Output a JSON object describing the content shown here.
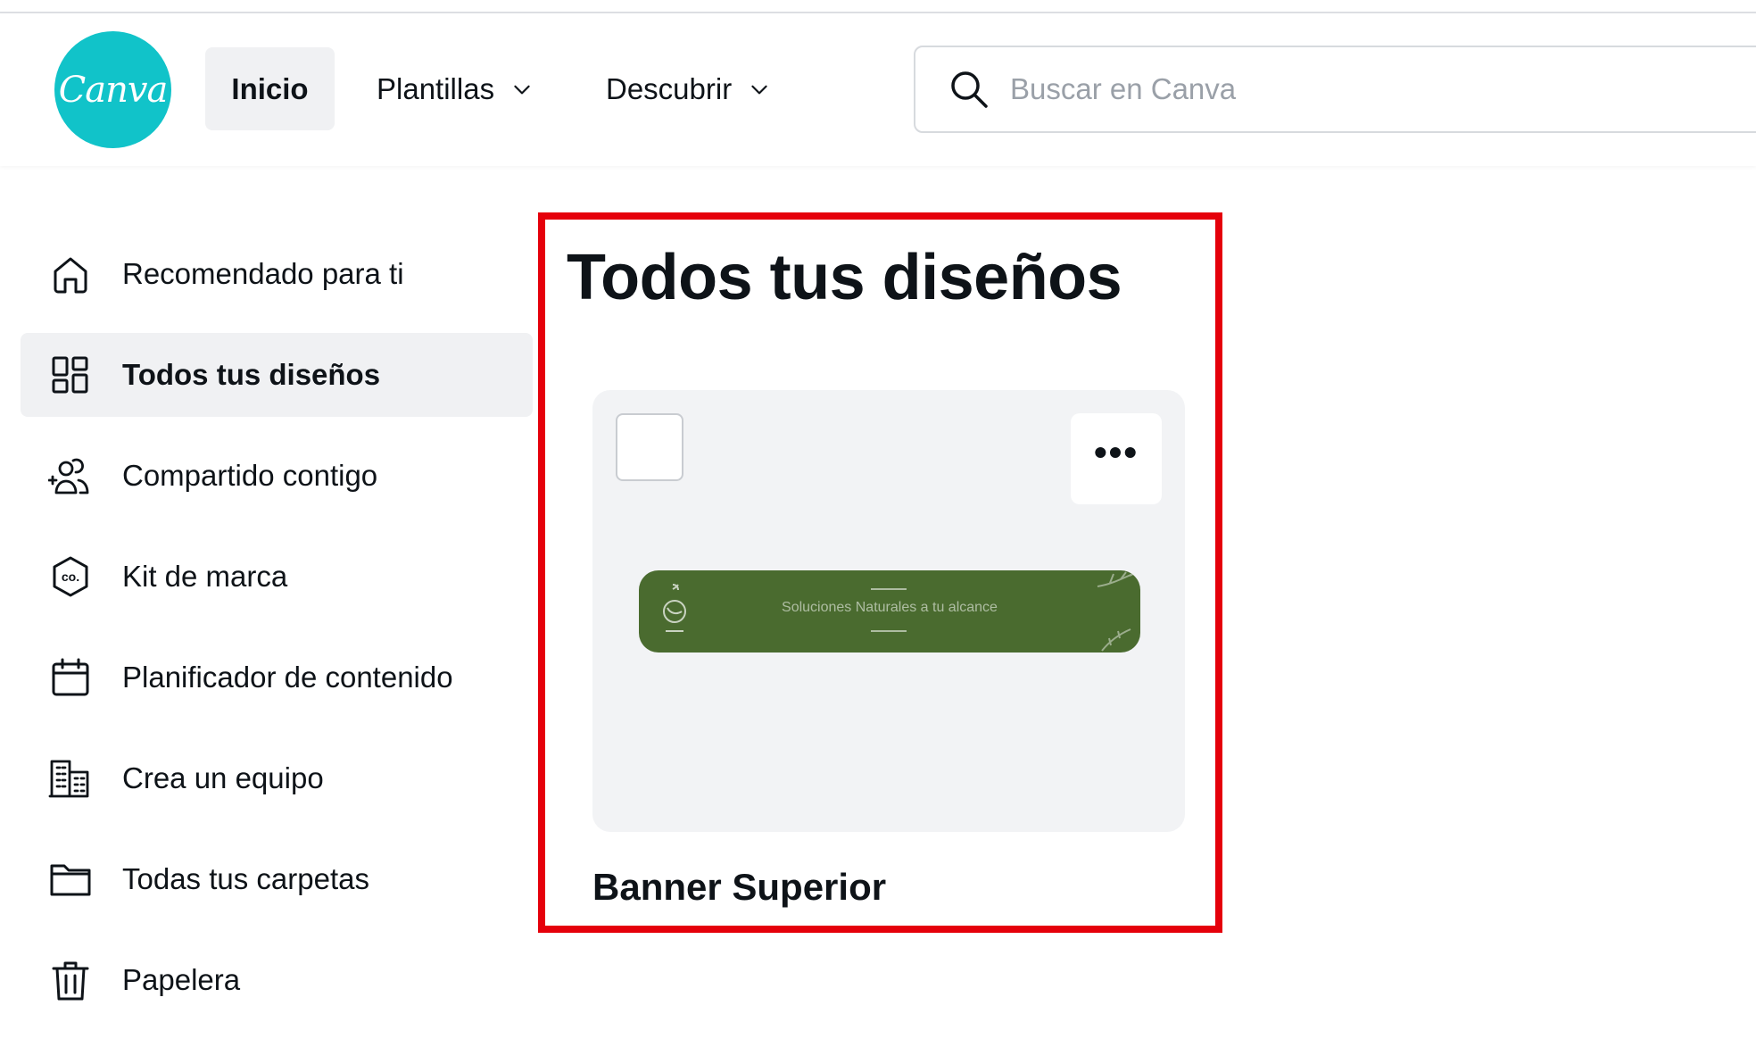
{
  "app": {
    "logo_text": "Canva",
    "brand_color": "#11c3c9"
  },
  "header": {
    "nav": [
      {
        "label": "Inicio",
        "active": true
      },
      {
        "label": "Plantillas",
        "icon": "chevron-down-icon"
      },
      {
        "label": "Descubrir",
        "icon": "chevron-down-icon"
      }
    ],
    "search": {
      "placeholder": "Buscar en Canva",
      "value": "",
      "icon": "search-icon"
    }
  },
  "sidebar": {
    "items": [
      {
        "label": "Recomendado para ti",
        "icon": "home-icon",
        "active": false
      },
      {
        "label": "Todos tus diseños",
        "icon": "grid-icon",
        "active": true
      },
      {
        "label": "Compartido contigo",
        "icon": "shared-people-icon",
        "active": false
      },
      {
        "label": "Kit de marca",
        "icon": "brand-kit-icon",
        "active": false
      },
      {
        "label": "Planificador de contenido",
        "icon": "calendar-icon",
        "active": false
      },
      {
        "label": "Crea un equipo",
        "icon": "building-icon",
        "active": false
      },
      {
        "label": "Todas tus carpetas",
        "icon": "folder-icon",
        "active": false
      },
      {
        "label": "Papelera",
        "icon": "trash-icon",
        "active": false
      }
    ]
  },
  "main": {
    "title": "Todos tus diseños",
    "highlight_color": "#e5000b",
    "designs": [
      {
        "title": "Banner Superior",
        "thumbnail_text": "Soluciones Naturales a tu alcance",
        "thumbnail_color": "#4a6b2f",
        "selected": false,
        "more_icon": "more-dots-icon"
      }
    ]
  }
}
